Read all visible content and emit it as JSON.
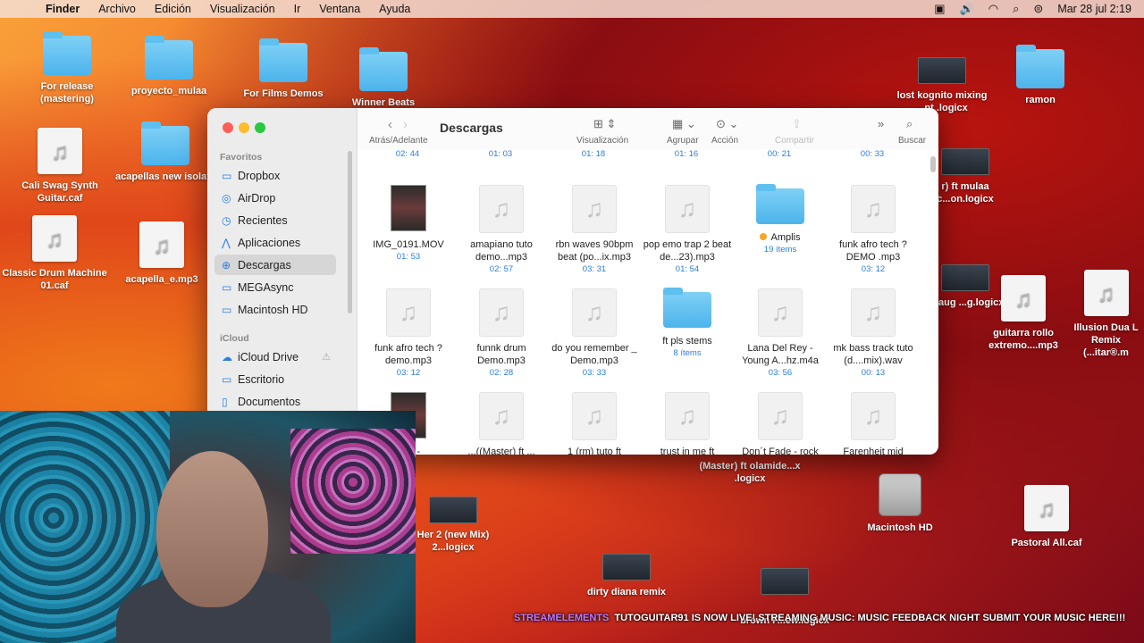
{
  "menubar": {
    "app": "Finder",
    "items": [
      "Archivo",
      "Edición",
      "Visualización",
      "Ir",
      "Ventana",
      "Ayuda"
    ],
    "datetime": "Mar 28 jul 2:19"
  },
  "desktop": {
    "icons": [
      {
        "label": "For release (mastering)",
        "kind": "folder"
      },
      {
        "label": "proyecto_mulaa",
        "kind": "folder"
      },
      {
        "label": "For Films Demos",
        "kind": "folder"
      },
      {
        "label": "Winner Beats",
        "kind": "folder"
      },
      {
        "label": "lost kognito mixing ...pt .logicx",
        "kind": "project"
      },
      {
        "label": "ramon",
        "kind": "folder"
      },
      {
        "label": "Cali Swag Synth Guitar.caf",
        "kind": "audio"
      },
      {
        "label": "acapellas new isolate",
        "kind": "folder"
      },
      {
        "label": "Classic Drum Machine 01.caf",
        "kind": "audio"
      },
      {
        "label": "acapella_e.mp3",
        "kind": "audio"
      },
      {
        "label": "r) ft mulaa c...on.logicx",
        "kind": "project"
      },
      {
        "label": ") Zaug ...g.logicx",
        "kind": "project"
      },
      {
        "label": "guitarra rollo extremo....mp3",
        "kind": "audio"
      },
      {
        "label": "Illusion Dua L Remix (...itar®.m",
        "kind": "audio"
      },
      {
        "label": "(Master) ft olamide...x .logicx",
        "kind": "project"
      },
      {
        "label": "Her 2 (new Mix) 2...logicx",
        "kind": "project"
      },
      {
        "label": "Macintosh HD",
        "kind": "disk"
      },
      {
        "label": "Pastoral All.caf",
        "kind": "audio"
      },
      {
        "label": "dirty diana remix",
        "kind": "project"
      },
      {
        "label": "brown F...ew.logicx",
        "kind": "project"
      }
    ]
  },
  "finder": {
    "title": "Descargas",
    "nav_label": "Atrás/Adelante",
    "toolbar": {
      "view": "Visualización",
      "group": "Agrupar",
      "action": "Acción",
      "share": "Compartir",
      "search": "Buscar"
    },
    "sidebar": {
      "favorites_label": "Favoritos",
      "favorites": [
        "Dropbox",
        "AirDrop",
        "Recientes",
        "Aplicaciones",
        "Descargas",
        "MEGAsync",
        "Macintosh HD"
      ],
      "icloud_label": "iCloud",
      "icloud": [
        "iCloud Drive",
        "Escritorio",
        "Documentos"
      ]
    },
    "top_durations": [
      "02: 44",
      "01: 03",
      "01: 18",
      "01: 16",
      "00: 21",
      "00: 33"
    ],
    "rows": [
      [
        {
          "name": "IMG_0191.MOV",
          "meta": "01: 53",
          "kind": "video"
        },
        {
          "name": "amapiano tuto demo...mp3",
          "meta": "02: 57",
          "kind": "audio"
        },
        {
          "name": "rbn waves 90bpm beat (po...ix.mp3",
          "meta": "03: 31",
          "kind": "audio"
        },
        {
          "name": "pop emo trap 2 beat de...23).mp3",
          "meta": "01: 54",
          "kind": "audio"
        },
        {
          "name": "Amplis",
          "meta": "19 ítems",
          "kind": "folder",
          "tag": true
        },
        {
          "name": "funk afro tech ? DEMO .mp3",
          "meta": "03: 12",
          "kind": "audio"
        }
      ],
      [
        {
          "name": "funk afro tech ? demo.mp3",
          "meta": "03: 12",
          "kind": "audio"
        },
        {
          "name": "funnk drum Demo.mp3",
          "meta": "02: 28",
          "kind": "audio"
        },
        {
          "name": "do you remember _ Demo.mp3",
          "meta": "03: 33",
          "kind": "audio"
        },
        {
          "name": "ft pls stems",
          "meta": "8 ítems",
          "kind": "folder"
        },
        {
          "name": "Lana Del Rey - Young A...hz.m4a",
          "meta": "03: 56",
          "kind": "audio"
        },
        {
          "name": "mk bass track tuto (d....mix).wav",
          "meta": "00: 13",
          "kind": "audio"
        }
      ],
      [
        {
          "name": "Rey -",
          "meta": "",
          "kind": "video"
        },
        {
          "name": "...((Master) ft ...",
          "meta": "",
          "kind": "audio"
        },
        {
          "name": "1 (rm) tuto ft",
          "meta": "",
          "kind": "audio"
        },
        {
          "name": "trust in me   ft",
          "meta": "",
          "kind": "audio"
        },
        {
          "name": "Don´t Fade - rock",
          "meta": "",
          "kind": "audio"
        },
        {
          "name": "Farenheit mid",
          "meta": "",
          "kind": "audio"
        }
      ]
    ]
  },
  "banner": {
    "brand": "STREAMELEMENTS",
    "text": "TUTOGUITAR91 IS NOW LIVE! STREAMING MUSIC: MUSIC FEEDBACK NIGHT SUBMIT YOUR MUSIC HERE!!!"
  },
  "colors": {
    "accent": "#2a7de1",
    "folder": "#4cb4ec",
    "tag_orange": "#f5a623"
  }
}
